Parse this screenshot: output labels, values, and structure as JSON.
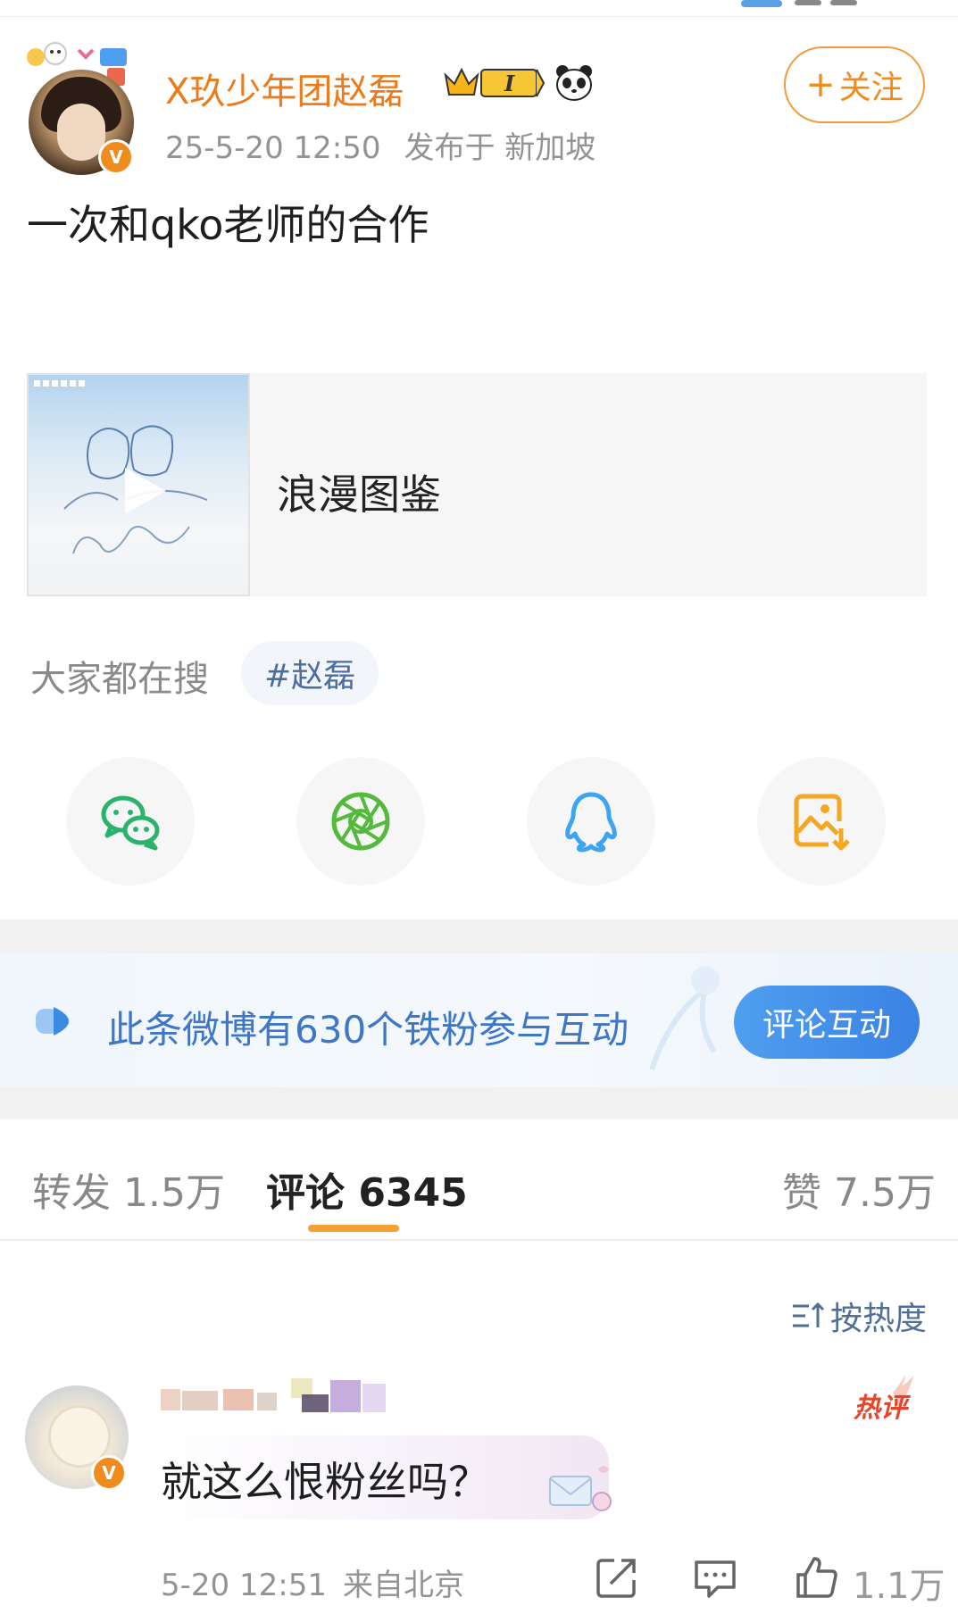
{
  "post": {
    "author": "X玖少年团赵磊",
    "time": "25-5-20 12:50",
    "location": "发布于 新加坡",
    "follow_label": "关注",
    "text": "一次和qko老师的合作"
  },
  "music": {
    "title": "浪漫图鉴"
  },
  "search": {
    "label": "大家都在搜",
    "tag": "#赵磊"
  },
  "share": {
    "items": [
      "wechat-icon",
      "moments-icon",
      "qq-icon",
      "save-image-icon"
    ]
  },
  "fans": {
    "text": "此条微博有630个铁粉参与互动",
    "button": "评论互动"
  },
  "tabs": {
    "repost": "转发 1.5万",
    "comment": "评论 6345",
    "like": "赞 7.5万"
  },
  "sort": {
    "label": "按热度"
  },
  "comment": {
    "hot_badge": "热评",
    "text": "就这么恨粉丝吗？",
    "time": "5-20 12:51",
    "location": "来自北京",
    "like_count": "1.1万"
  },
  "colors": {
    "accent_orange": "#eb7b1c",
    "link_blue": "#3e77c7",
    "button_blue": "#3a82e4",
    "hot_red": "#e8442b"
  }
}
